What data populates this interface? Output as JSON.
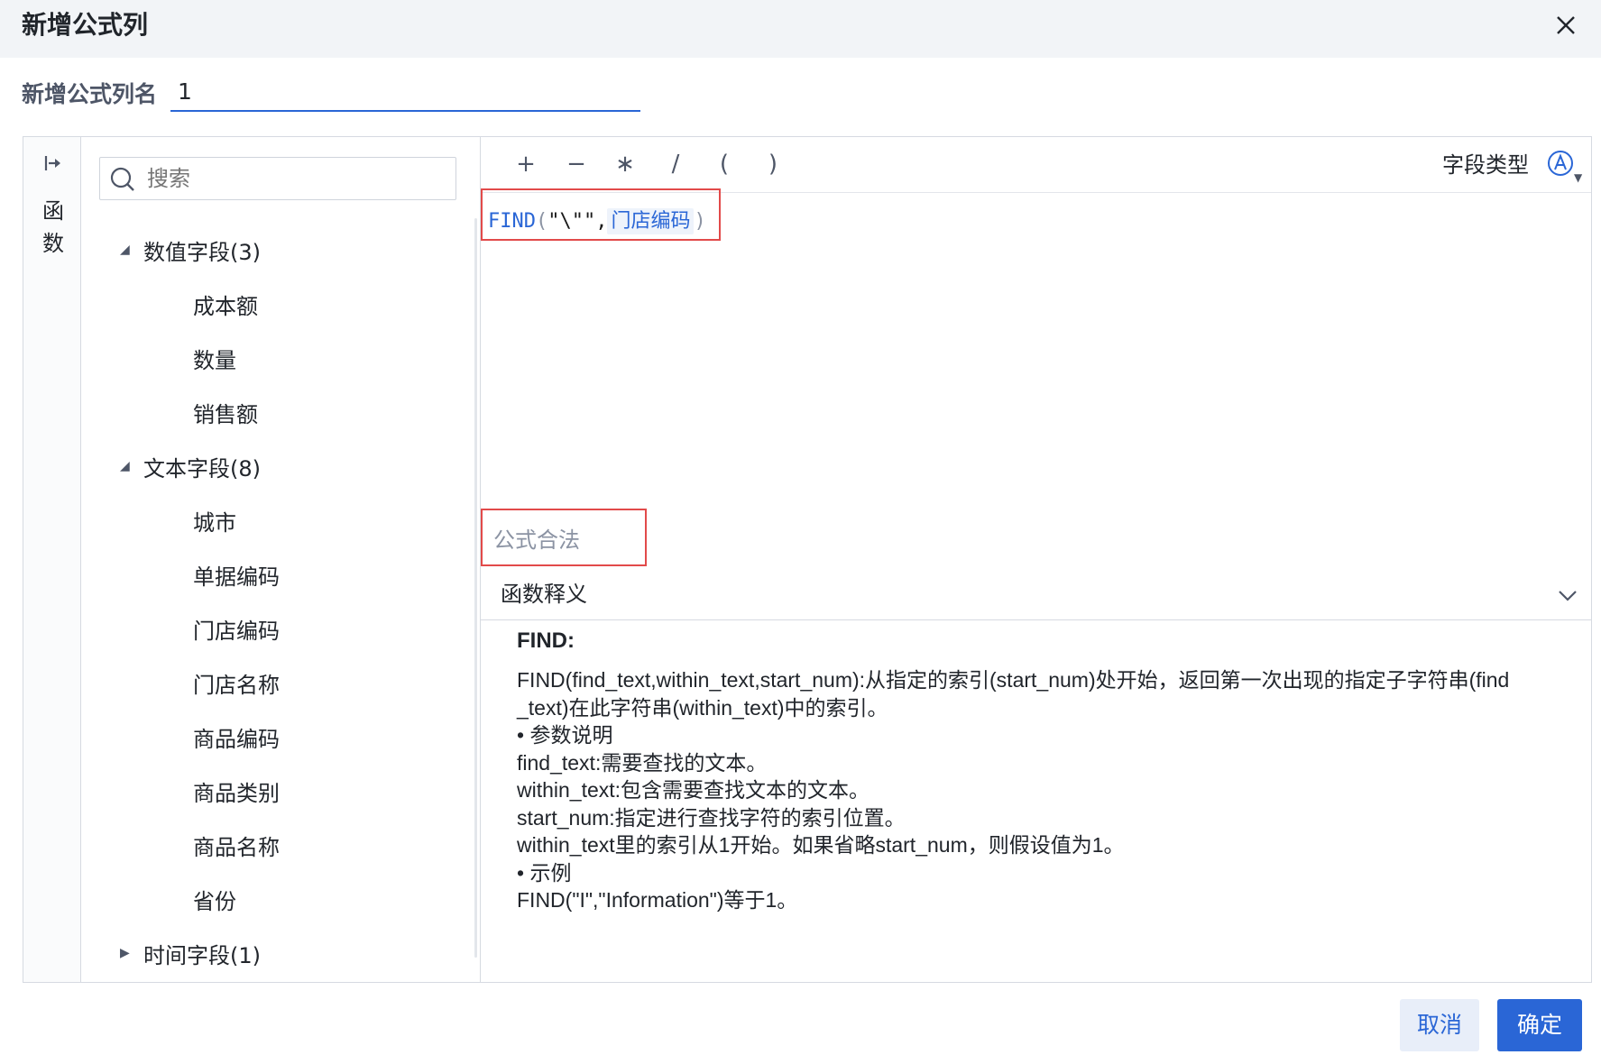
{
  "dialog": {
    "title": "新增公式列",
    "name_label": "新增公式列名",
    "name_value": "1"
  },
  "sidebar_tab": {
    "label": "函数",
    "icon": "collapse-arrow-icon"
  },
  "search": {
    "placeholder": "搜索",
    "icon": "search-icon"
  },
  "field_groups": [
    {
      "label": "数值字段(3)",
      "expanded": true,
      "items": [
        "成本额",
        "数量",
        "销售额"
      ]
    },
    {
      "label": "文本字段(8)",
      "expanded": true,
      "items": [
        "城市",
        "单据编码",
        "门店编码",
        "门店名称",
        "商品编码",
        "商品类别",
        "商品名称",
        "省份"
      ]
    },
    {
      "label": "时间字段(1)",
      "expanded": false,
      "items": []
    }
  ],
  "operators": [
    "+",
    "−",
    "∗",
    "/",
    "(",
    ")"
  ],
  "field_type": {
    "label": "字段类型",
    "icon": "text-type-icon"
  },
  "formula": {
    "fn": "FIND",
    "open": "(",
    "arg1": "\"\\\"\"",
    "comma": ",",
    "field": "门店编码",
    "close": ")"
  },
  "validation_text": "公式合法",
  "help": {
    "title": "函数释义",
    "name": "FIND:",
    "lines": [
      "FIND(find_text,within_text,start_num):从指定的索引(start_num)处开始，返回第一次出现的指定子字符串(find",
      "_text)在此字符串(within_text)中的索引。",
      "• 参数说明",
      "find_text:需要查找的文本。",
      "within_text:包含需要查找文本的文本。",
      "start_num:指定进行查找字符的索引位置。",
      "within_text里的索引从1开始。如果省略start_num，则假设值为1。",
      "• 示例",
      "FIND(\"I\",\"Information\")等于1。"
    ]
  },
  "buttons": {
    "cancel": "取消",
    "ok": "确定"
  },
  "colors": {
    "accent": "#2a66d6",
    "highlight_border": "#e24a4a",
    "title_bar": "#f2f4f7"
  }
}
